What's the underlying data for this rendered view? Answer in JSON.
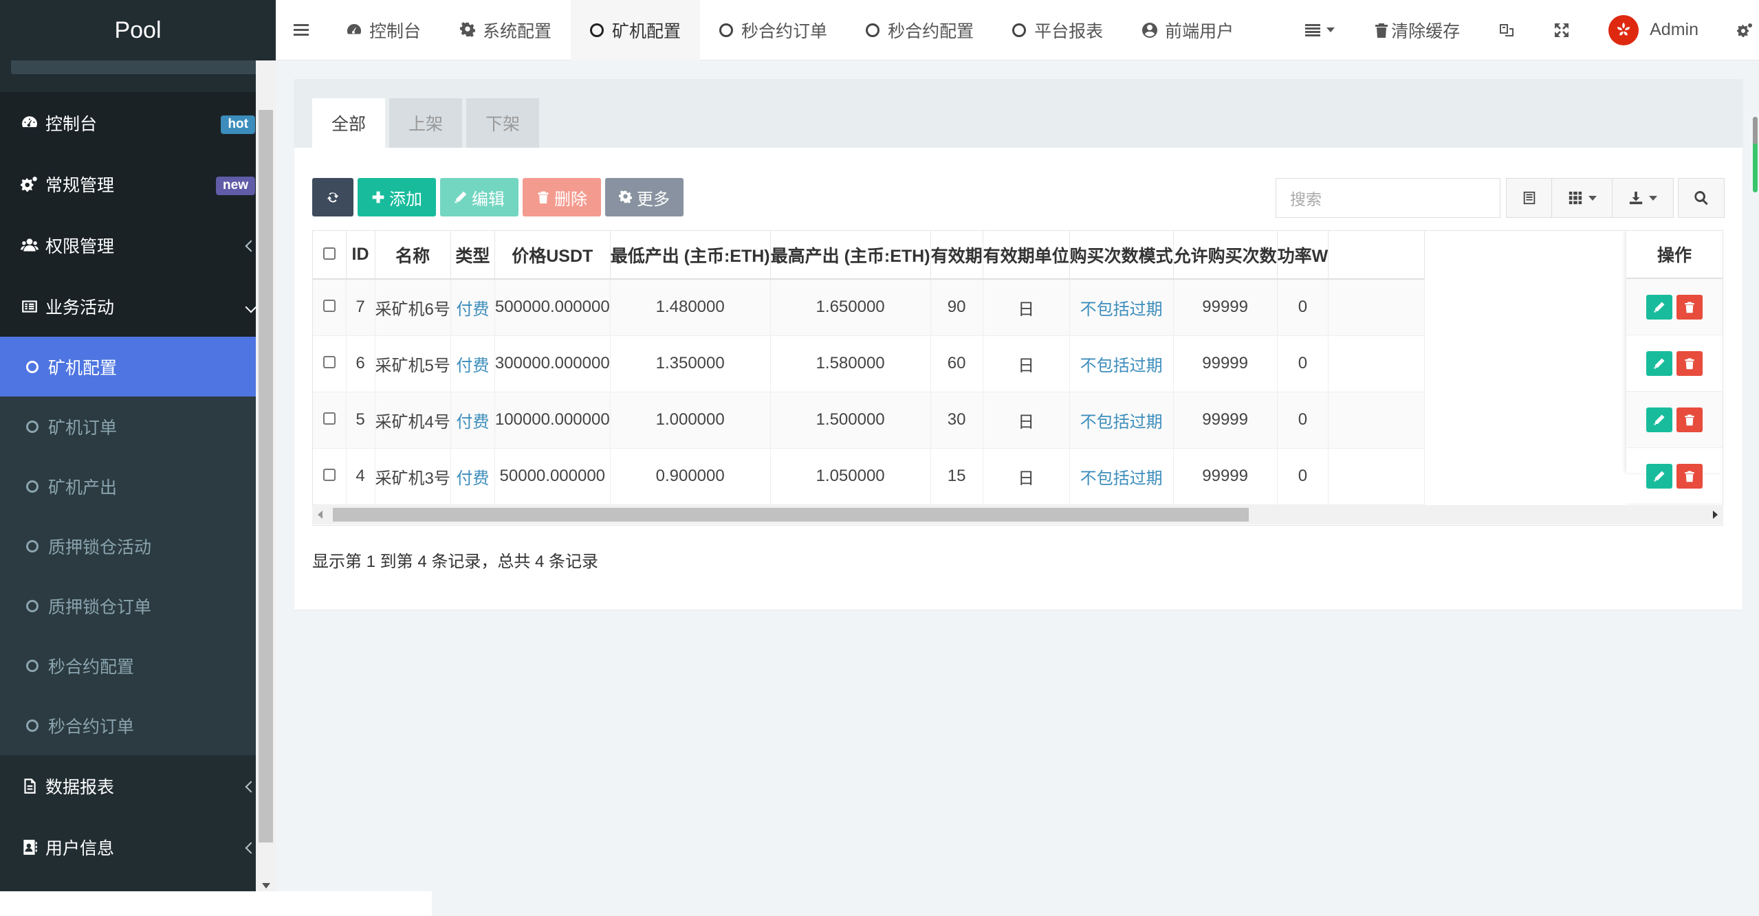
{
  "app": {
    "brand": "Pool"
  },
  "sidebar": {
    "items": [
      {
        "label": "控制台",
        "icon": "dashboard-icon",
        "badge": "hot"
      },
      {
        "label": "常规管理",
        "icon": "cogs-icon",
        "badge": "new"
      },
      {
        "label": "权限管理",
        "icon": "users-icon"
      },
      {
        "label": "业务活动",
        "icon": "list-alt-icon"
      },
      {
        "label": "数据报表",
        "icon": "file-text-icon"
      },
      {
        "label": "用户信息",
        "icon": "address-book-icon"
      }
    ],
    "sub_items": [
      {
        "label": "矿机配置"
      },
      {
        "label": "矿机订单"
      },
      {
        "label": "矿机产出"
      },
      {
        "label": "质押锁仓活动"
      },
      {
        "label": "质押锁仓订单"
      },
      {
        "label": "秒合约配置"
      },
      {
        "label": "秒合约订单"
      }
    ]
  },
  "header": {
    "nav": [
      {
        "label": "控制台",
        "icon": "dashboard-icon"
      },
      {
        "label": "系统配置",
        "icon": "gear-icon"
      },
      {
        "label": "矿机配置",
        "icon": "circle-o-icon"
      },
      {
        "label": "秒合约订单",
        "icon": "circle-o-icon"
      },
      {
        "label": "秒合约配置",
        "icon": "circle-o-icon"
      },
      {
        "label": "平台报表",
        "icon": "circle-o-icon"
      },
      {
        "label": "前端用户",
        "icon": "user-circle-icon"
      }
    ],
    "clear_cache": "清除缓存",
    "admin": "Admin"
  },
  "panel": {
    "tabs": [
      "全部",
      "上架",
      "下架"
    ],
    "toolbar": {
      "add": "添加",
      "edit": "编辑",
      "delete": "删除",
      "more": "更多"
    },
    "search_placeholder": "搜索"
  },
  "table": {
    "columns": [
      "ID",
      "名称",
      "类型",
      "价格USDT",
      "最低产出 (主币:ETH)",
      "最高产出 (主币:ETH)",
      "有效期",
      "有效期单位",
      "购买次数模式",
      "允许购买次数",
      "功率W",
      "操作"
    ],
    "rows": [
      {
        "id": "7",
        "name": "采矿机6号",
        "type": "付费",
        "price": "500000.000000",
        "min": "1.480000",
        "max": "1.650000",
        "period": "90",
        "unit": "日",
        "mode": "不包括过期",
        "times": "99999",
        "power": "0"
      },
      {
        "id": "6",
        "name": "采矿机5号",
        "type": "付费",
        "price": "300000.000000",
        "min": "1.350000",
        "max": "1.580000",
        "period": "60",
        "unit": "日",
        "mode": "不包括过期",
        "times": "99999",
        "power": "0"
      },
      {
        "id": "5",
        "name": "采矿机4号",
        "type": "付费",
        "price": "100000.000000",
        "min": "1.000000",
        "max": "1.500000",
        "period": "30",
        "unit": "日",
        "mode": "不包括过期",
        "times": "99999",
        "power": "0"
      },
      {
        "id": "4",
        "name": "采矿机3号",
        "type": "付费",
        "price": "50000.000000",
        "min": "0.900000",
        "max": "1.050000",
        "period": "15",
        "unit": "日",
        "mode": "不包括过期",
        "times": "99999",
        "power": "0"
      }
    ]
  },
  "pager": {
    "info": "显示第 1 到第 4 条记录，总共 4 条记录"
  },
  "colors": {
    "sidebar": "#222d32",
    "active": "#4e75e1",
    "green": "#18bc9c",
    "red": "#e74c3c"
  }
}
